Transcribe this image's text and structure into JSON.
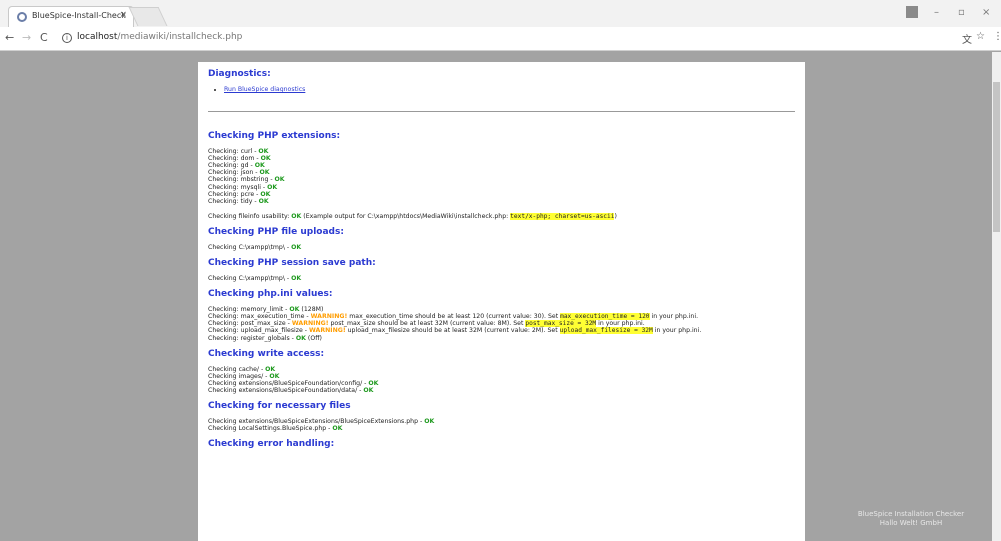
{
  "browser": {
    "tab_title": "BlueSpice-Install-Check",
    "url_host": "localhost",
    "url_path": "/mediawiki/installcheck.php",
    "nav_back": "←",
    "nav_forward": "→",
    "nav_reload": "C",
    "info_glyph": "i",
    "tab_close": "×",
    "win_minimize": "–",
    "win_restore": "▫",
    "win_close": "×",
    "translate_glyph": "⽂",
    "star_glyph": "☆",
    "menu_glyph": "⋮"
  },
  "sections": {
    "diagnostics_title": "Diagnostics:",
    "diagnostics_link": "Run BlueSpice diagnostics",
    "php_ext_title": "Checking PHP extensions:",
    "uploads_title": "Checking PHP file uploads:",
    "session_title": "Checking PHP session save path:",
    "ini_title": "Checking php.ini values:",
    "write_title": "Checking write access:",
    "files_title": "Checking for necessary files",
    "error_title": "Checking error handling:"
  },
  "labels": {
    "ok": "OK",
    "warning": "WARNING!"
  },
  "php_extensions": [
    "Checking: curl - ",
    "Checking: dom - ",
    "Checking: gd - ",
    "Checking: json - ",
    "Checking: mbstring - ",
    "Checking: mysqli - ",
    "Checking: pcre - ",
    "Checking: tidy - "
  ],
  "fileinfo": {
    "prefix": "Checking fileinfo usability: ",
    "middle": " (Example output for C:\\xampp\\htdocs\\MediaWiki\\installcheck.php: ",
    "code": "text/x-php; charset=us-ascii",
    "suffix": ")"
  },
  "uploads_line": "Checking C:\\xampp\\tmp\\ - ",
  "session_line": "Checking C:\\xampp\\tmp\\ - ",
  "ini": {
    "memory_prefix": "Checking: memory_limit - ",
    "memory_suffix": " (128M)",
    "exec_prefix": "Checking: max_execution_time - ",
    "exec_msg": " max_execution_time should be at least 120 (current value: 30). Set ",
    "exec_code": "max_execution_time = 120",
    "exec_tail": " in your php.ini.",
    "post_prefix": "Checking: post_max_size - ",
    "post_msg": " post_max_size should be at least 32M (current value: 8M). Set ",
    "post_code": "post_max_size = 32M",
    "post_tail": " in your php.ini.",
    "upload_prefix": "Checking: upload_max_filesize - ",
    "upload_msg": " upload_max_filesize should be at least 32M (current value: 2M). Set ",
    "upload_code": "upload_max_filesize = 32M",
    "upload_tail": " in your php.ini.",
    "globals_prefix": "Checking: register_globals - ",
    "globals_suffix": " (Off)"
  },
  "write_access": [
    "Checking cache/ - ",
    "Checking images/ - ",
    "Checking extensions/BlueSpiceFoundation/config/ - ",
    "Checking extensions/BlueSpiceFoundation/data/ - "
  ],
  "necessary_files": [
    "Checking extensions/BlueSpiceExtensions/BlueSpiceExtensions.php - ",
    "Checking LocalSettings.BlueSpice.php - "
  ],
  "footer": {
    "line1": "BlueSpice Installation Checker",
    "line2": "Hallo Welt! GmbH"
  }
}
